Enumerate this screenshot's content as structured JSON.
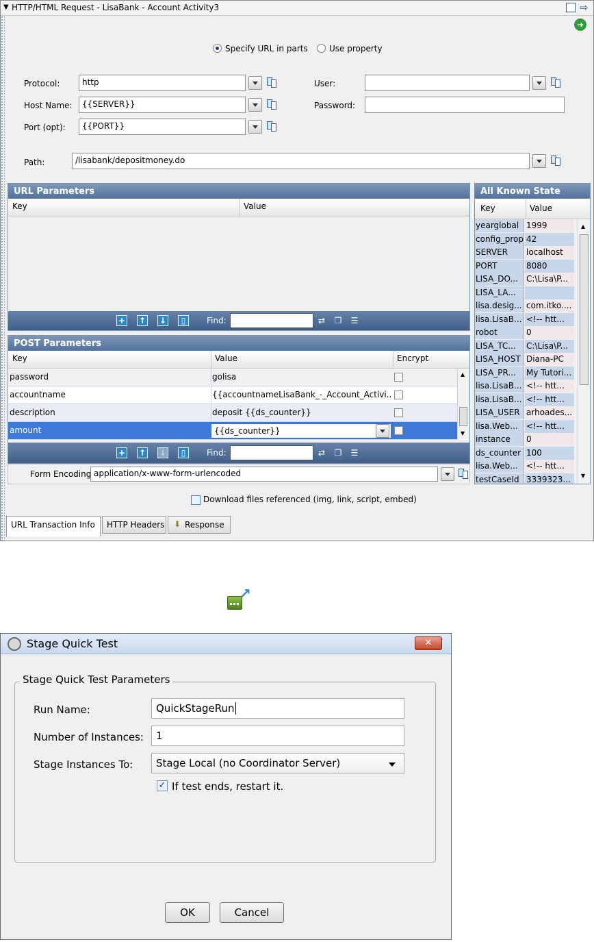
{
  "panel": {
    "title": "HTTP/HTML Request - LisaBank - Account Activity3",
    "title_arrow": "▼",
    "url_mode": {
      "specify_label": "Specify URL in parts",
      "property_label": "Use property",
      "selected": "specify"
    },
    "protocol": {
      "label": "Protocol:",
      "value": "http"
    },
    "host": {
      "label": "Host Name:",
      "value": "{{SERVER}}"
    },
    "port": {
      "label": "Port (opt):",
      "value": "{{PORT}}"
    },
    "user": {
      "label": "User:",
      "value": ""
    },
    "password": {
      "label": "Password:",
      "value": ""
    },
    "path": {
      "label": "Path:",
      "value": "/lisabank/depositmoney.do"
    },
    "url_params": {
      "header": "URL Parameters",
      "columns": [
        "Key",
        "Value"
      ],
      "find_label": "Find:"
    },
    "post_params": {
      "header": "POST Parameters",
      "columns": [
        "Key",
        "Value",
        "Encrypt"
      ],
      "rows": [
        {
          "key": "password",
          "value": "golisa",
          "encrypt": false
        },
        {
          "key": "accountname",
          "value": "{{accountnameLisaBank_-_Account_Activi...",
          "encrypt": false
        },
        {
          "key": "description",
          "value": "deposit {{ds_counter}}",
          "encrypt": false
        },
        {
          "key": "amount",
          "value": "{{ds_counter}}",
          "encrypt": false
        }
      ],
      "find_label": "Find:"
    },
    "form_encoding": {
      "label": "Form Encoding:",
      "value": "application/x-www-form-urlencoded"
    },
    "download_label": "Download files referenced (img, link, script, embed)",
    "tabs": [
      "URL Transaction Info",
      "HTTP Headers",
      "Response"
    ],
    "known_state": {
      "header": "All Known State",
      "columns": [
        "Key",
        "Value"
      ],
      "rows": [
        {
          "key": "yearglobal",
          "value": "1999"
        },
        {
          "key": "config_prop",
          "value": "42"
        },
        {
          "key": "SERVER",
          "value": "localhost"
        },
        {
          "key": "PORT",
          "value": "8080"
        },
        {
          "key": "LISA_DO...",
          "value": "C:\\Lisa\\P..."
        },
        {
          "key": "LISA_LA...",
          "value": ""
        },
        {
          "key": "lisa.desig...",
          "value": "com.itko...."
        },
        {
          "key": "lisa.LisaB...",
          "value": "<!-- htt..."
        },
        {
          "key": "robot",
          "value": "0"
        },
        {
          "key": "LISA_TC...",
          "value": "C:\\Lisa\\P..."
        },
        {
          "key": "LISA_HOST",
          "value": "Diana-PC"
        },
        {
          "key": "LISA_PR...",
          "value": "My Tutori..."
        },
        {
          "key": "lisa.LisaB...",
          "value": "<!-- htt..."
        },
        {
          "key": "lisa.LisaB...",
          "value": "<!-- htt..."
        },
        {
          "key": "LISA_USER",
          "value": "arhoades..."
        },
        {
          "key": "lisa.Web...",
          "value": "<!-- htt..."
        },
        {
          "key": "instance",
          "value": "0"
        },
        {
          "key": "ds_counter",
          "value": "100"
        },
        {
          "key": "lisa.Web...",
          "value": "<!-- htt..."
        },
        {
          "key": "testCaseId",
          "value": "3339323..."
        }
      ]
    }
  },
  "dialog": {
    "title": "Stage Quick Test",
    "group_label": "Stage Quick Test Parameters",
    "run_name": {
      "label": "Run Name:",
      "value": "QuickStageRun"
    },
    "instances": {
      "label": "Number of Instances:",
      "value": "1"
    },
    "stage_to": {
      "label": "Stage Instances To:",
      "value": "Stage Local (no Coordinator Server)"
    },
    "restart": {
      "label": "If test ends, restart it.",
      "checked": true
    },
    "ok_label": "OK",
    "cancel_label": "Cancel",
    "close_glyph": "✕"
  }
}
